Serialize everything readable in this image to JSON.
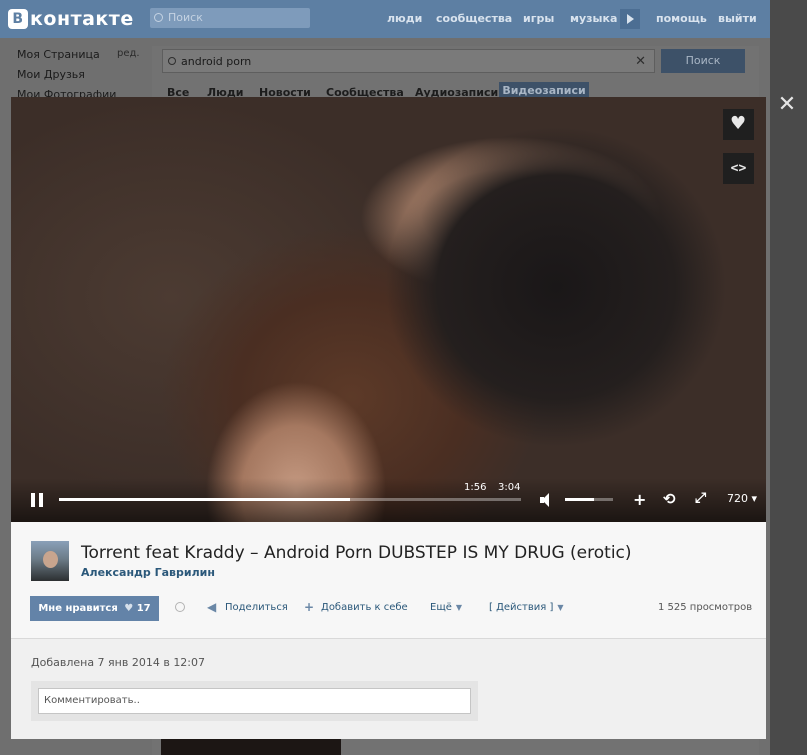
{
  "topbar": {
    "logo": "контакте",
    "logo_letter": "B",
    "search_placeholder": "Поиск",
    "nav": [
      "люди",
      "сообщества",
      "игры",
      "музыка",
      "помощь",
      "выйти"
    ]
  },
  "leftmenu": {
    "items": [
      "Моя Страница",
      "Мои Друзья",
      "Мои Фотографии"
    ],
    "edit": "ред."
  },
  "search": {
    "query": "android porn",
    "button": "Поиск",
    "tabs": [
      "Все",
      "Люди",
      "Новости",
      "Сообщества",
      "Аудиозаписи",
      "Видеозаписи"
    ],
    "active_tab": "Видеозаписи"
  },
  "player": {
    "current_time": "1:56",
    "duration": "3:04",
    "progress": 0.63,
    "volume": 0.6,
    "quality": "720"
  },
  "video": {
    "title": "Torrent feat Kraddy – Android Porn DUBSTEP IS MY DRUG (erotic)",
    "author": "Александр Гаврилин",
    "like_label": "Мне нравится",
    "like_count": "17",
    "share": "Поделиться",
    "add": "Добавить к себе",
    "more": "Ещё",
    "actions": "[ Действия ]",
    "views": "1 525 просмотров",
    "added": "Добавлена 7 янв 2014 в 12:07",
    "comment_placeholder": "Комментировать.."
  }
}
